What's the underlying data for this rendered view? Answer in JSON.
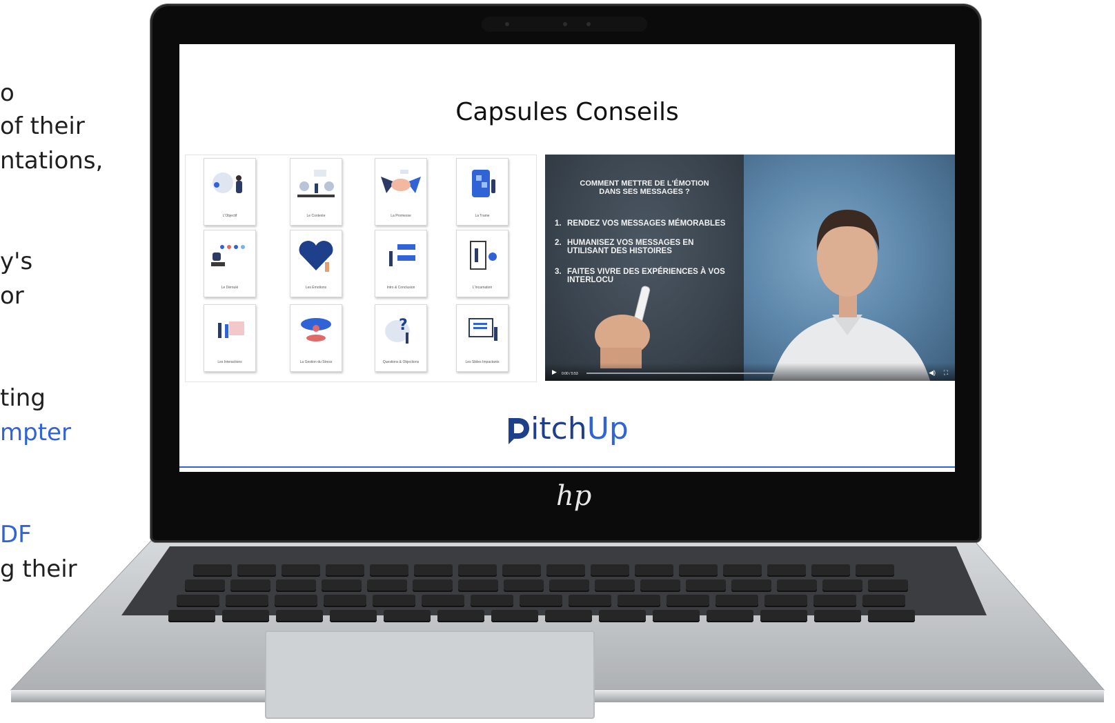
{
  "left_text": {
    "lines": [
      {
        "text": "o",
        "blue": false
      },
      {
        "text": " of their",
        "blue": false
      },
      {
        "text": "ntations,",
        "blue": false
      },
      {
        "text": "y's",
        "blue": false
      },
      {
        "text": " or",
        "blue": false
      },
      {
        "text": "ting",
        "blue": false
      },
      {
        "text": "mpter",
        "blue": true
      },
      {
        "text": "DF",
        "blue": true
      },
      {
        "text": "g their",
        "blue": false
      }
    ]
  },
  "screen": {
    "title": "Capsules Conseils",
    "cards": [
      {
        "label": "L'Objectif",
        "icon": "person-presenting-icon"
      },
      {
        "label": "Le Contexte",
        "icon": "people-park-icon"
      },
      {
        "label": "La Promesse",
        "icon": "handshake-icon"
      },
      {
        "label": "La Trame",
        "icon": "puzzle-icon"
      },
      {
        "label": "Le Déroulé",
        "icon": "timeline-icon"
      },
      {
        "label": "Les Émotions",
        "icon": "heart-icon"
      },
      {
        "label": "Intro & Conclusion",
        "icon": "checklist-icon"
      },
      {
        "label": "L'Incarnation",
        "icon": "mirror-icon"
      },
      {
        "label": "Les Interactions",
        "icon": "meeting-icon"
      },
      {
        "label": "La Gestion du Stress",
        "icon": "meditation-icon"
      },
      {
        "label": "Questions & Objections",
        "icon": "question-icon"
      },
      {
        "label": "Les Slides Impactants",
        "icon": "slides-icon"
      }
    ],
    "video": {
      "heading_line1": "COMMENT METTRE DE L'ÉMOTION",
      "heading_line2": "DANS SES MESSAGES ?",
      "items": [
        {
          "num": "1.",
          "line1": "RENDEZ VOS MESSAGES MÉMORABLES",
          "line2": ""
        },
        {
          "num": "2.",
          "line1": "HUMANISEZ VOS MESSAGES EN",
          "line2": "UTILISANT DES HISTOIRES"
        },
        {
          "num": "3.",
          "line1": "FAITES VIVRE DES EXPÉRIENCES À VOS",
          "line2": "INTERLOCU"
        }
      ],
      "time": "0:00 / 5:53"
    },
    "logo": {
      "part1": "itch",
      "part2": "Up"
    }
  },
  "brand": "hp",
  "colors": {
    "accent": "#2f63d6",
    "logo_dark": "#1e3f8a"
  }
}
